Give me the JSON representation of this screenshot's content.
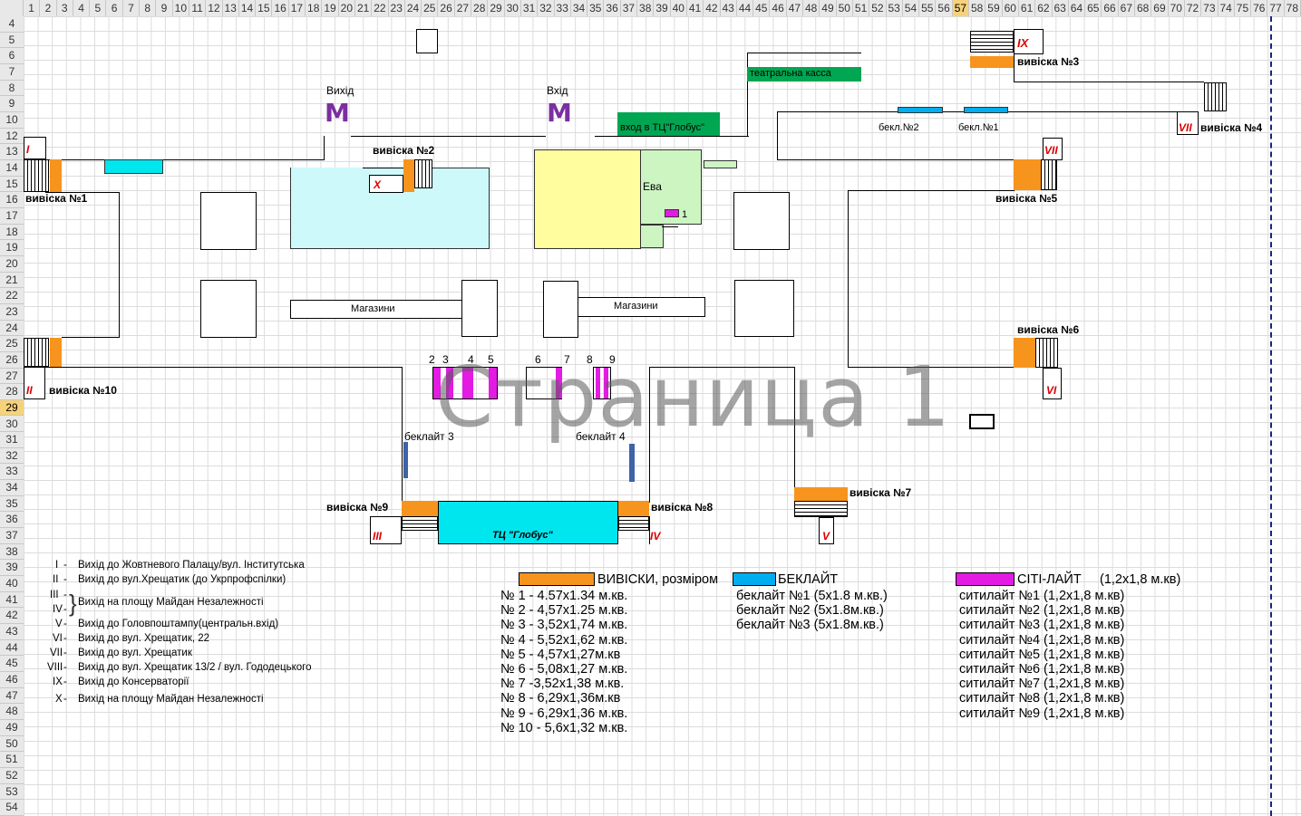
{
  "columns": [
    "1",
    "2",
    "3",
    "4",
    "5",
    "6",
    "7",
    "8",
    "9",
    "10",
    "11",
    "12",
    "13",
    "14",
    "15",
    "16",
    "17",
    "18",
    "19",
    "20",
    "21",
    "22",
    "23",
    "24",
    "25",
    "26",
    "27",
    "28",
    "29",
    "30",
    "31",
    "32",
    "33",
    "34",
    "35",
    "36",
    "37",
    "38",
    "39",
    "40",
    "41",
    "42",
    "43",
    "44",
    "45",
    "46",
    "47",
    "48",
    "49",
    "50",
    "51",
    "52",
    "53",
    "54",
    "55",
    "56",
    "57",
    "58",
    "59",
    "60",
    "61",
    "62",
    "63",
    "64",
    "65",
    "66",
    "67",
    "68",
    "69",
    "70",
    "72",
    "73",
    "74",
    "75",
    "76",
    "77",
    "78"
  ],
  "selected_column": "57",
  "rows": [
    "4",
    "5",
    "6",
    "7",
    "8",
    "9",
    "10",
    "12",
    "13",
    "14",
    "15",
    "16",
    "17",
    "18",
    "19",
    "20",
    "21",
    "22",
    "23",
    "24",
    "25",
    "26",
    "27",
    "28",
    "29",
    "30",
    "31",
    "32",
    "33",
    "34",
    "35",
    "36",
    "37",
    "38",
    "39",
    "40",
    "41",
    "42",
    "43",
    "44",
    "45",
    "46",
    "47",
    "48",
    "49",
    "50",
    "51",
    "52",
    "53",
    "54"
  ],
  "selected_row": "29",
  "watermark": "Страница 1",
  "map": {
    "exit_label": "Вихід",
    "entrance_label": "Вхід",
    "metro_symbol": "M",
    "theatre_box_office": "театральна касса",
    "globus_entrance": "вход в ТЦ\"Глобус\"",
    "eva": "Ева",
    "citylight_1": "1",
    "shops_left": "Магазини",
    "shops_right": "Магазини",
    "backlight_2": "бекл.№2",
    "backlight_1": "бекл.№1",
    "backlight_3": "беклайт 3",
    "backlight_4": "беклайт 4",
    "globus_mall": "ТЦ \"Глобус\"",
    "signs": {
      "s1": "вивіска №1",
      "s2": "вивіска №2",
      "s3": "вивіска №3",
      "s4": "вивіска №4",
      "s5": "вивіска №5",
      "s6": "вивіска №6",
      "s7": "вивіска №7",
      "s8": "вивіска №8",
      "s9": "вивіска №9",
      "s10": "вивіска №10"
    },
    "roman": {
      "I": "I",
      "II": "II",
      "III": "III",
      "IV": "IV",
      "V": "V",
      "VI": "VI",
      "VII": "VII",
      "VIII": "VII",
      "IX": "IX",
      "X": "X"
    },
    "citylight_numbers": [
      "2",
      "3",
      "4",
      "5",
      "6",
      "7",
      "8",
      "9"
    ]
  },
  "exits": [
    {
      "num": "I",
      "dash": "-",
      "text": "Вихід до Жовтневого Палацу/вул. Інститутська"
    },
    {
      "num": "II",
      "dash": "-",
      "text": "Вихід до вул.Хрещатик (до Укрпрофспілки)"
    },
    {
      "num": "III",
      "dash": "-",
      "text": ""
    },
    {
      "num": "IV",
      "dash": "-",
      "text": ""
    },
    {
      "num": "V",
      "dash": "-",
      "text": "Вихід до Головпоштампу(центральн.вхід)"
    },
    {
      "num": "VI",
      "dash": "-",
      "text": "Вихід до вул. Хрещатик, 22"
    },
    {
      "num": "VII",
      "dash": "-",
      "text": "Вихід до вул. Хрещатик"
    },
    {
      "num": "VIII",
      "dash": "-",
      "text": "Вихід до вул. Хрещатик 13/2 / вул. Гододецького"
    },
    {
      "num": "IX",
      "dash": "-",
      "text": "Вихід до Консерваторії"
    },
    {
      "num": "X",
      "dash": "-",
      "text": "Вихід на площу Майдан Незалежності"
    }
  ],
  "exits_3_4_text": "Вихід на площу Майдан Незалежності",
  "legend": {
    "signs_title": "ВИВІСКИ, розміром",
    "backlight_title": "БЕКЛАЙТ",
    "citylight_title": "СІТІ-ЛАЙТ",
    "citylight_size": "(1,2x1,8 м.кв)",
    "colors": {
      "signs": "#f7941d",
      "backlight": "#00aeef",
      "citylight": "#e31be3"
    },
    "signs": [
      "№  1 - 4.57х1.34 м.кв.",
      "№  2 - 4,57х1.25 м.кв.",
      "№  3 - 3,52х1,74 м.кв.",
      "№  4 - 5,52х1,62 м.кв.",
      "№  5 - 4,57х1,27м.кв",
      "№  6 - 5,08х1,27 м.кв.",
      "№  7 -3,52х1,38 м.кв.",
      "№  8 - 6,29х1,36м.кв",
      "№  9 - 6,29х1,36 м.кв.",
      "№  10 - 5,6х1,32 м.кв."
    ],
    "backlights": [
      "беклайт №1 (5х1.8 м.кв.)",
      "беклайт №2 (5х1.8м.кв.)",
      "беклайт №3 (5х1.8м.кв.)"
    ],
    "citylights": [
      "ситилайт №1 (1,2х1,8 м.кв)",
      "ситилайт №2 (1,2х1,8 м.кв)",
      "ситилайт №3 (1,2х1,8 м.кв)",
      "ситилайт №4 (1,2х1,8 м.кв)",
      "ситилайт №5 (1,2х1,8 м.кв)",
      "ситилайт №6 (1,2х1,8 м.кв)",
      "ситилайт №7 (1,2х1,8 м.кв)",
      "ситилайт №8 (1,2х1,8 м.кв)",
      "ситилайт №9 (1,2х1,8 м.кв)"
    ]
  }
}
